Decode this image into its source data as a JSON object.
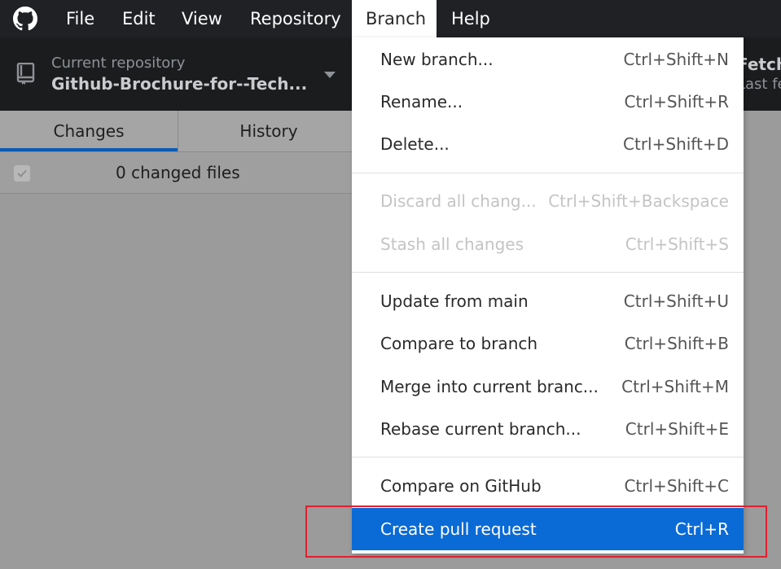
{
  "menubar": {
    "items": [
      "File",
      "Edit",
      "View",
      "Repository",
      "Branch",
      "Help"
    ],
    "active": "Branch"
  },
  "toolbar": {
    "repo_caption": "Current repository",
    "repo_name": "Github-Brochure-for--Tech...",
    "fetch_title": "Fetch",
    "fetch_sub": "Last fe"
  },
  "tabs": [
    "Changes",
    "History"
  ],
  "changes": {
    "summary": "0 changed files"
  },
  "branch_menu": {
    "items": [
      {
        "label": "New branch...",
        "shortcut": "Ctrl+Shift+N"
      },
      {
        "label": "Rename...",
        "shortcut": "Ctrl+Shift+R"
      },
      {
        "label": "Delete...",
        "shortcut": "Ctrl+Shift+D"
      },
      {
        "label": "Discard all chang...",
        "shortcut": "Ctrl+Shift+Backspace"
      },
      {
        "label": "Stash all changes",
        "shortcut": "Ctrl+Shift+S"
      },
      {
        "label": "Update from main",
        "shortcut": "Ctrl+Shift+U"
      },
      {
        "label": "Compare to branch",
        "shortcut": "Ctrl+Shift+B"
      },
      {
        "label": "Merge into current branc...",
        "shortcut": "Ctrl+Shift+M"
      },
      {
        "label": "Rebase current branch...",
        "shortcut": "Ctrl+Shift+E"
      },
      {
        "label": "Compare on GitHub",
        "shortcut": "Ctrl+Shift+C"
      },
      {
        "label": "Create pull request",
        "shortcut": "Ctrl+R"
      }
    ]
  },
  "colors": {
    "menubar_bg": "#1f2124",
    "toolbar_bg": "#1b1c1e",
    "selected_item_bg": "#0a6ad6",
    "highlight_border": "#e0202e"
  }
}
